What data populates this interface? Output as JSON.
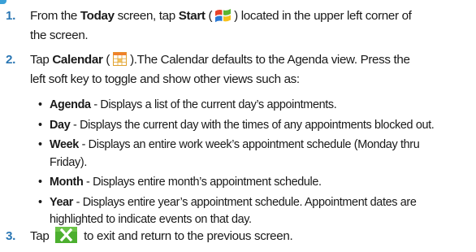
{
  "steps": [
    {
      "number": "1.",
      "line1": {
        "t1": "From the ",
        "b1": "Today",
        "t2": " screen, tap ",
        "b2": "Start",
        "t3": " (",
        "t4": ") located in the upper left corner of"
      },
      "line2": "the screen.",
      "icon": "windows-start-flag-icon"
    },
    {
      "number": "2.",
      "line1": {
        "t1": "Tap ",
        "b1": "Calendar",
        "t2": " (",
        "t3": ").The Calendar defaults to the Agenda view. Press the"
      },
      "line2": "left soft key to toggle and show other views such as:",
      "icon": "calendar-icon"
    },
    {
      "number": "3.",
      "line1": {
        "t1": "Tap ",
        "t2": " to exit and return to the previous screen."
      },
      "icon": "close-x-icon"
    }
  ],
  "views": [
    {
      "bullet": "•",
      "term": "Agenda",
      "line1": " - Displays a list of the current day’s appointments.",
      "line2": ""
    },
    {
      "bullet": "•",
      "term": "Day",
      "line1": " - Displays the current day with the times of any appointments blocked out.",
      "line2": ""
    },
    {
      "bullet": "•",
      "term": "Week",
      "line1": " - Displays an entire work week’s appointment schedule (Monday thru",
      "line2": "Friday)."
    },
    {
      "bullet": "•",
      "term": "Month",
      "line1": " - Displays entire month’s appointment schedule.",
      "line2": ""
    },
    {
      "bullet": "•",
      "term": "Year",
      "line1": " - Displays entire year’s appointment schedule. Appointment dates are",
      "line2": "highlighted to indicate events on that day."
    }
  ],
  "colors": {
    "step_number": "#2a76b3",
    "text": "#1a1a1a",
    "x_button": "#4caf2f"
  }
}
